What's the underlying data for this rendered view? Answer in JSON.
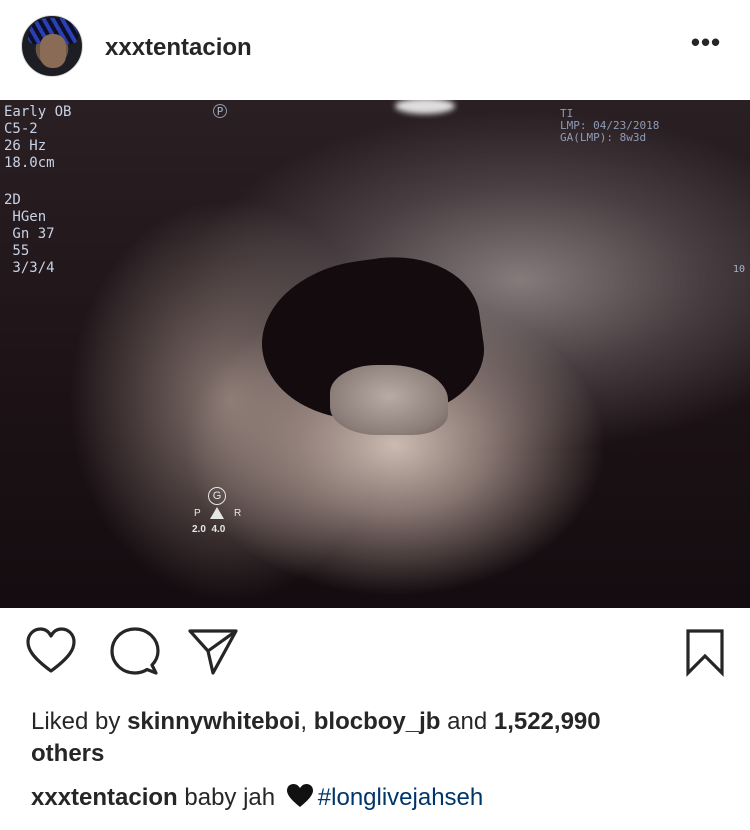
{
  "post": {
    "username": "xxxtentacion",
    "more_label": "•••",
    "photo": {
      "scan_info_left": [
        "Early OB",
        "C5-2",
        "26 Hz",
        "18.0cm"
      ],
      "scan_info_left2": [
        "2D",
        " HGen",
        " Gn 37",
        " 55",
        " 3/3/4"
      ],
      "scan_info_right": [
        "TI",
        "LMP: 04/23/2018",
        "GA(LMP): 8w3d"
      ],
      "side_marker": "10",
      "probe_marker": "P",
      "orientation": {
        "g": "G",
        "p": "P",
        "r": "R",
        "scale": "2.0  4.0"
      }
    },
    "actions": {
      "like_icon": "heart-outline-icon",
      "comment_icon": "speech-bubble-icon",
      "share_icon": "paper-plane-icon",
      "save_icon": "bookmark-icon"
    },
    "likes": {
      "prefix": "Liked by ",
      "user1": "skinnywhiteboi",
      "sep": ", ",
      "user2": "blocboy_jb",
      "and": " and ",
      "count": "1,522,990",
      "suffix": "others"
    },
    "caption": {
      "username": "xxxtentacion",
      "text": " baby jah ",
      "emoji": "black-heart-emoji",
      "hashtag": "#longlivejahseh"
    }
  },
  "colors": {
    "text": "#262626",
    "hashtag": "#003569",
    "background": "#ffffff"
  }
}
